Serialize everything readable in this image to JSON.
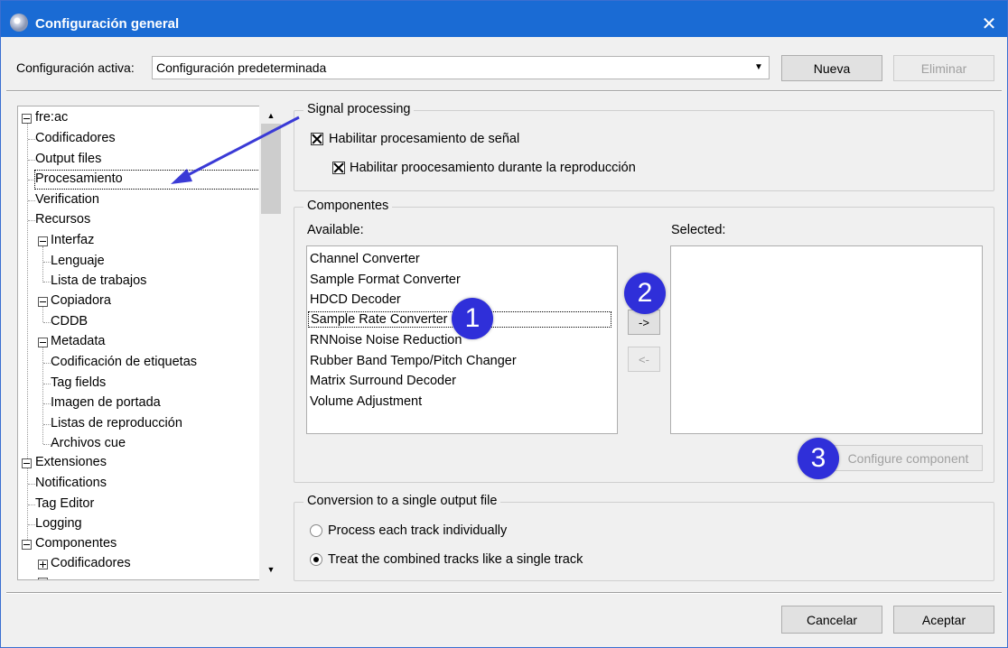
{
  "window": {
    "title": "Configuración general",
    "close_glyph": "✕",
    "app_icon": "freac-disc-icon"
  },
  "config": {
    "label": "Configuración activa:",
    "value": "Configuración predeterminada",
    "new_label": "Nueva",
    "delete_label": "Eliminar"
  },
  "tree": {
    "items": [
      {
        "label": "fre:ac"
      },
      {
        "label": "Codificadores"
      },
      {
        "label": "Output files"
      },
      {
        "label": "Procesamiento"
      },
      {
        "label": "Verification"
      },
      {
        "label": "Recursos"
      },
      {
        "label": "Interfaz"
      },
      {
        "label": "Lenguaje"
      },
      {
        "label": "Lista de trabajos"
      },
      {
        "label": "Copiadora"
      },
      {
        "label": "CDDB"
      },
      {
        "label": "Metadata"
      },
      {
        "label": "Codificación de etiquetas"
      },
      {
        "label": "Tag fields"
      },
      {
        "label": "Imagen de portada"
      },
      {
        "label": "Listas de reproducción"
      },
      {
        "label": "Archivos cue"
      },
      {
        "label": "Extensiones"
      },
      {
        "label": "Notifications"
      },
      {
        "label": "Tag Editor"
      },
      {
        "label": "Logging"
      },
      {
        "label": "Componentes"
      },
      {
        "label": "Codificadores"
      }
    ],
    "selected": "Procesamiento"
  },
  "signal": {
    "title": "Signal processing",
    "enable_label": "Habilitar procesamiento de señal",
    "enable_checked": true,
    "playback_label": "Habilitar proocesamiento durante la reproducción",
    "playback_checked": true
  },
  "components": {
    "title": "Componentes",
    "available_label": "Available:",
    "selected_label": "Selected:",
    "available": [
      "Channel Converter",
      "Sample Format Converter",
      "HDCD Decoder",
      "Sample Rate Converter",
      "RNNoise Noise Reduction",
      "Rubber Band Tempo/Pitch Changer",
      "Matrix Surround Decoder",
      "Volume Adjustment"
    ],
    "add_label": "->",
    "remove_label": "<-",
    "configure_label": "Configure component"
  },
  "conversion": {
    "title": "Conversion to a single output file",
    "option1": "Process each track individually",
    "option2": "Treat the combined tracks like a single track",
    "selected": "option2"
  },
  "footer": {
    "cancel_label": "Cancelar",
    "accept_label": "Aceptar"
  },
  "annotations": {
    "badge1": "1",
    "badge2": "2",
    "badge3": "3",
    "accent": "#2f2fd9"
  }
}
